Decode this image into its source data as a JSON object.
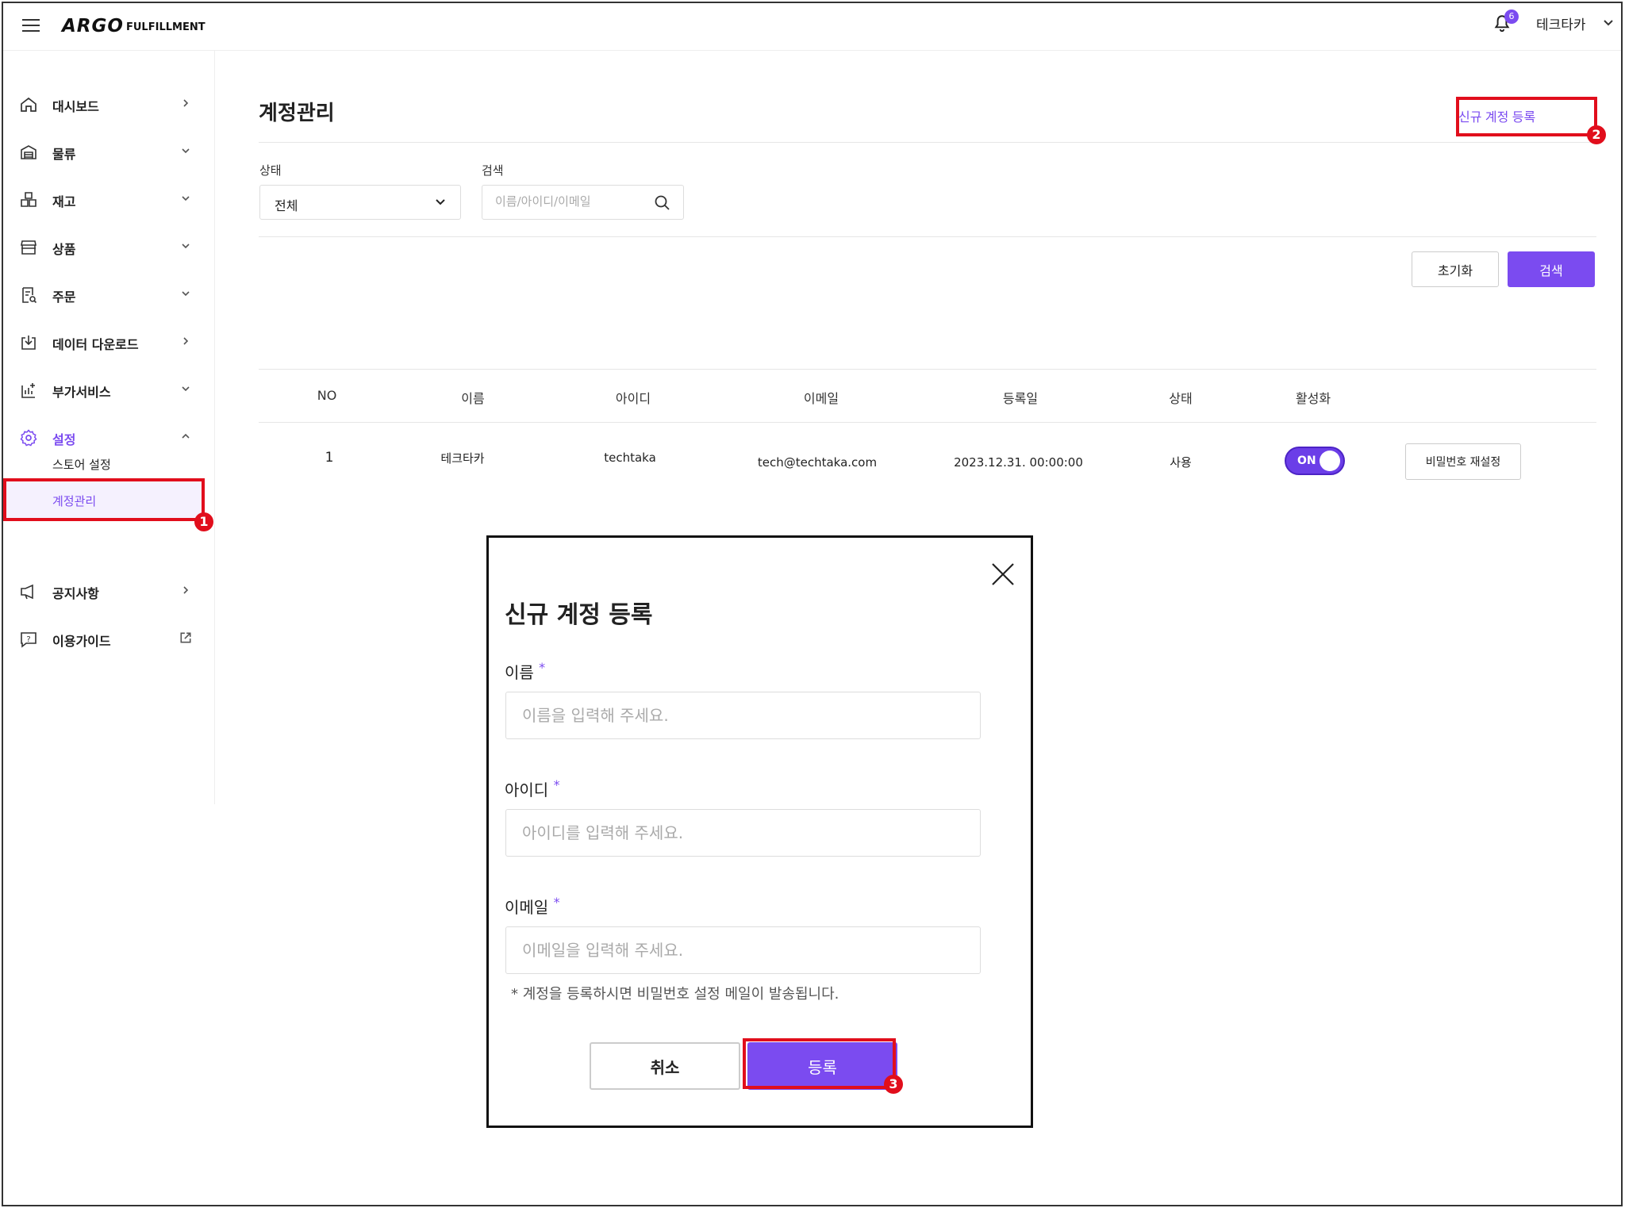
{
  "app": {
    "logo": "ARGO",
    "logo_sub": "FULFILLMENT",
    "notification_count": "6",
    "user_name": "테크타카",
    "accent_color": "#7b4bf0",
    "highlight_color": "#e10e1c"
  },
  "sidebar": {
    "items": [
      {
        "label": "대시보드",
        "icon": "home-icon"
      },
      {
        "label": "물류",
        "icon": "warehouse-icon"
      },
      {
        "label": "재고",
        "icon": "boxes-icon"
      },
      {
        "label": "상품",
        "icon": "store-icon"
      },
      {
        "label": "주문",
        "icon": "order-search-icon"
      },
      {
        "label": "데이터 다운로드",
        "icon": "download-icon"
      },
      {
        "label": "부가서비스",
        "icon": "add-chart-icon"
      },
      {
        "label": "설정",
        "icon": "gear-icon"
      },
      {
        "label": "공지사항",
        "icon": "megaphone-icon"
      },
      {
        "label": "이용가이드",
        "icon": "help-icon"
      }
    ],
    "sub_items": [
      {
        "label": "스토어 설정"
      },
      {
        "label": "계정관리"
      }
    ]
  },
  "page": {
    "title": "계정관리",
    "new_account_link": "신규 계정 등록"
  },
  "filters": {
    "status_label": "상태",
    "status_value": "전체",
    "search_label": "검색",
    "search_placeholder": "이름/아이디/이메일",
    "reset_button": "초기화",
    "search_button": "검색"
  },
  "table": {
    "columns": [
      "NO",
      "이름",
      "아이디",
      "이메일",
      "등록일",
      "상태",
      "활성화"
    ],
    "rows": [
      {
        "no": "1",
        "name": "테크타카",
        "id": "techtaka",
        "email": "tech@techtaka.com",
        "registered": "2023.12.31. 00:00:00",
        "status": "사용",
        "active": "ON",
        "action": "비밀번호 재설정"
      }
    ]
  },
  "modal": {
    "title": "신규 계정 등록",
    "name_label": "이름",
    "name_placeholder": "이름을 입력해 주세요.",
    "id_label": "아이디",
    "id_placeholder": "아이디를 입력해 주세요.",
    "email_label": "이메일",
    "email_placeholder": "이메일을 입력해 주세요.",
    "required_mark": "*",
    "note": "* 계정을 등록하시면 비밀번호 설정 메일이 발송됩니다.",
    "cancel_button": "취소",
    "submit_button": "등록"
  },
  "markers": [
    "1",
    "2",
    "3"
  ]
}
